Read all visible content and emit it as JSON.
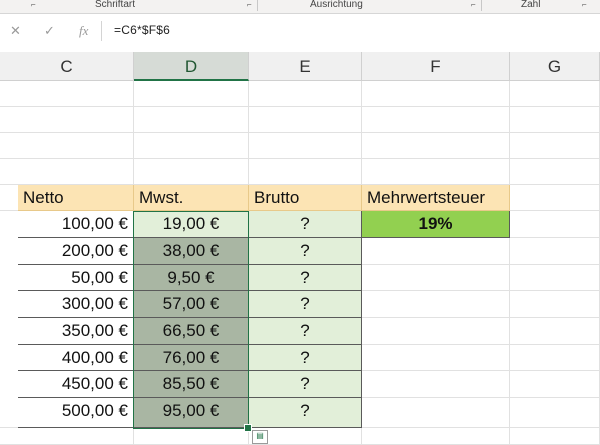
{
  "ribbon": {
    "group_font": "Schriftart",
    "group_alignment": "Ausrichtung",
    "group_number": "Zahl"
  },
  "formula_bar": {
    "cancel_icon": "✕",
    "enter_icon": "✓",
    "fx_label": "fx",
    "formula": "=C6*$F$6"
  },
  "columns": [
    "C",
    "D",
    "E",
    "F",
    "G"
  ],
  "selected_column": "D",
  "table": {
    "headers": {
      "netto": "Netto",
      "mwst": "Mwst.",
      "brutto": "Brutto",
      "rate_label": "Mehrwertsteuer"
    },
    "rate_value": "19%",
    "rows": [
      {
        "netto": "100,00 €",
        "mwst": "19,00 €",
        "brutto": "?"
      },
      {
        "netto": "200,00 €",
        "mwst": "38,00 €",
        "brutto": "?"
      },
      {
        "netto": "50,00 €",
        "mwst": "9,50 €",
        "brutto": "?"
      },
      {
        "netto": "300,00 €",
        "mwst": "57,00 €",
        "brutto": "?"
      },
      {
        "netto": "350,00 €",
        "mwst": "66,50 €",
        "brutto": "?"
      },
      {
        "netto": "400,00 €",
        "mwst": "76,00 €",
        "brutto": "?"
      },
      {
        "netto": "450,00 €",
        "mwst": "85,50 €",
        "brutto": "?"
      },
      {
        "netto": "500,00 €",
        "mwst": "95,00 €",
        "brutto": "?"
      }
    ]
  },
  "colors": {
    "header_fill": "#fce4b4",
    "green_light": "#e2efd9",
    "green_rate": "#92d050",
    "selection": "#217346"
  }
}
